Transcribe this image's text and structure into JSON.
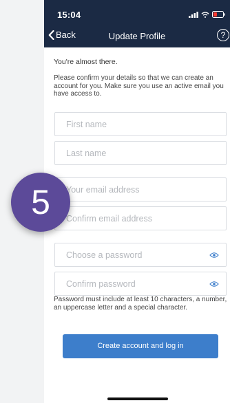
{
  "status_bar": {
    "time": "15:04",
    "signal_icon": "signal-icon",
    "wifi_icon": "wifi-icon",
    "battery_icon": "battery-icon"
  },
  "nav": {
    "back_label": "Back",
    "title": "Update Profile",
    "help_label": "?"
  },
  "intro": {
    "lead": "You're almost there.",
    "description": "Please confirm your details so that we can create an account for you. Make sure you use an active email you have access to."
  },
  "fields": {
    "first_name": {
      "placeholder": "First name"
    },
    "last_name": {
      "placeholder": "Last name"
    },
    "email": {
      "placeholder": "Your email address"
    },
    "confirm_email": {
      "placeholder": "Confirm email address"
    },
    "password": {
      "placeholder": "Choose a password"
    },
    "confirm_password": {
      "placeholder": "Confirm password"
    }
  },
  "password_hint": "Password must include at least 10 characters, a number, an uppercase letter and a special character.",
  "submit_label": "Create account and log in",
  "step_badge": "5",
  "colors": {
    "nav_bg": "#1b2a44",
    "button": "#3d7ecb",
    "badge": "#5c4a99"
  }
}
